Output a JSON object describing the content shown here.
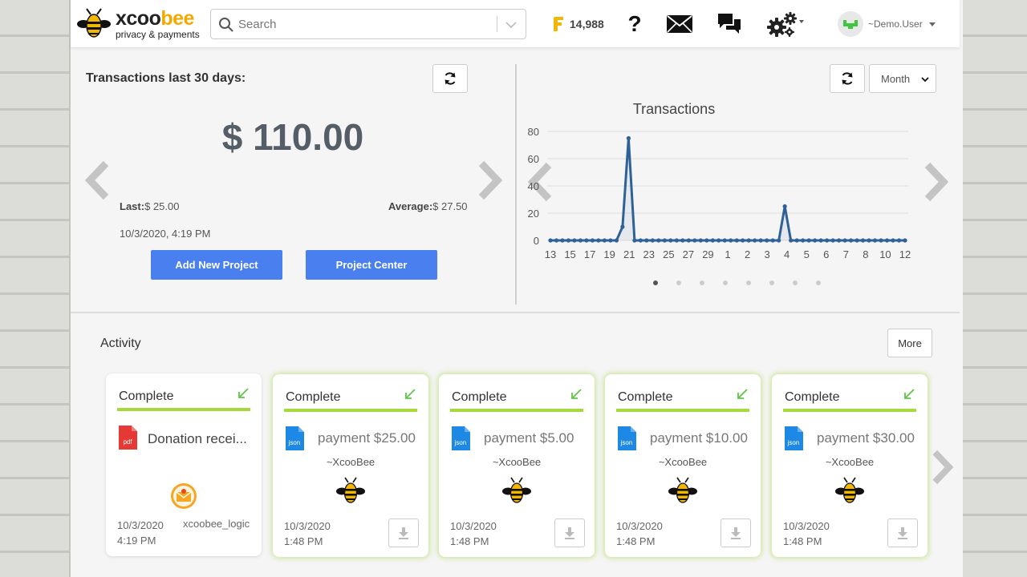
{
  "brand": {
    "word_a": "xcoo",
    "word_b": "bee",
    "tagline": "privacy & payments"
  },
  "search": {
    "placeholder": "Search"
  },
  "header": {
    "points": "14,988",
    "help_label": "?",
    "user_name": "~Demo.User"
  },
  "summary": {
    "title": "Transactions last 30 days:",
    "amount": "$ 110.00",
    "last_label": "Last:",
    "last_value": "$ 25.00",
    "average_label": "Average:",
    "average_value": "$ 27.50",
    "timestamp": "10/3/2020, 4:19 PM",
    "add_project_label": "Add New Project",
    "project_center_label": "Project Center"
  },
  "chart_panel": {
    "period_select": "Month",
    "pager_dots": 8,
    "active_dot": 0
  },
  "chart_data": {
    "type": "line",
    "title": "Transactions",
    "x": [
      "13",
      "14",
      "15",
      "16",
      "17",
      "18",
      "19",
      "20",
      "21",
      "22",
      "23",
      "24",
      "25",
      "26",
      "27",
      "28",
      "29",
      "30",
      "1",
      "2",
      "3",
      "4",
      "5",
      "6",
      "7",
      "8",
      "9",
      "10",
      "11",
      "12"
    ],
    "x_tick_labels": [
      "13",
      "15",
      "17",
      "19",
      "21",
      "23",
      "25",
      "27",
      "29",
      "1",
      "2",
      "3",
      "4",
      "5",
      "6",
      "7",
      "8",
      "10",
      "12"
    ],
    "series": [
      {
        "values": [
          0,
          0,
          0,
          0,
          0,
          0,
          0,
          0,
          0,
          0,
          0,
          0,
          10,
          75,
          0,
          0,
          0,
          0,
          0,
          0,
          0,
          0,
          0,
          0,
          0,
          0,
          0,
          0,
          0,
          0,
          0,
          0,
          0,
          0,
          0,
          0,
          0,
          0,
          0,
          25,
          0,
          0,
          0,
          0,
          0,
          0,
          0,
          0,
          0,
          0,
          0,
          0,
          0,
          0,
          0,
          0,
          0,
          0,
          0,
          0
        ]
      }
    ],
    "ylim": [
      0,
      80
    ],
    "y_ticks": [
      0,
      20,
      40,
      60,
      80
    ],
    "grid": true,
    "color": "#2f6196"
  },
  "activity": {
    "title": "Activity",
    "more_label": "More",
    "cards": [
      {
        "status": "Complete",
        "file_type": "pdf",
        "description": "Donation recei...",
        "date": "10/3/2020",
        "time": "4:19 PM",
        "by": "xcoobee_logic"
      },
      {
        "status": "Complete",
        "file_type": "json",
        "payment": "payment $25.00",
        "sender": "~XcooBee",
        "date": "10/3/2020",
        "time": "1:48 PM"
      },
      {
        "status": "Complete",
        "file_type": "json",
        "payment": "payment $5.00",
        "sender": "~XcooBee",
        "date": "10/3/2020",
        "time": "1:48 PM"
      },
      {
        "status": "Complete",
        "file_type": "json",
        "payment": "payment $10.00",
        "sender": "~XcooBee",
        "date": "10/3/2020",
        "time": "1:48 PM"
      },
      {
        "status": "Complete",
        "file_type": "json",
        "payment": "payment $30.00",
        "sender": "~XcooBee",
        "date": "10/3/2020",
        "time": "1:48 PM"
      }
    ]
  },
  "colors": {
    "accent_blue": "#4a7ff0",
    "complete_green": "#a6d93a",
    "line_blue": "#2f6196",
    "pdf_red": "#e53935",
    "json_blue": "#1e88e5"
  }
}
